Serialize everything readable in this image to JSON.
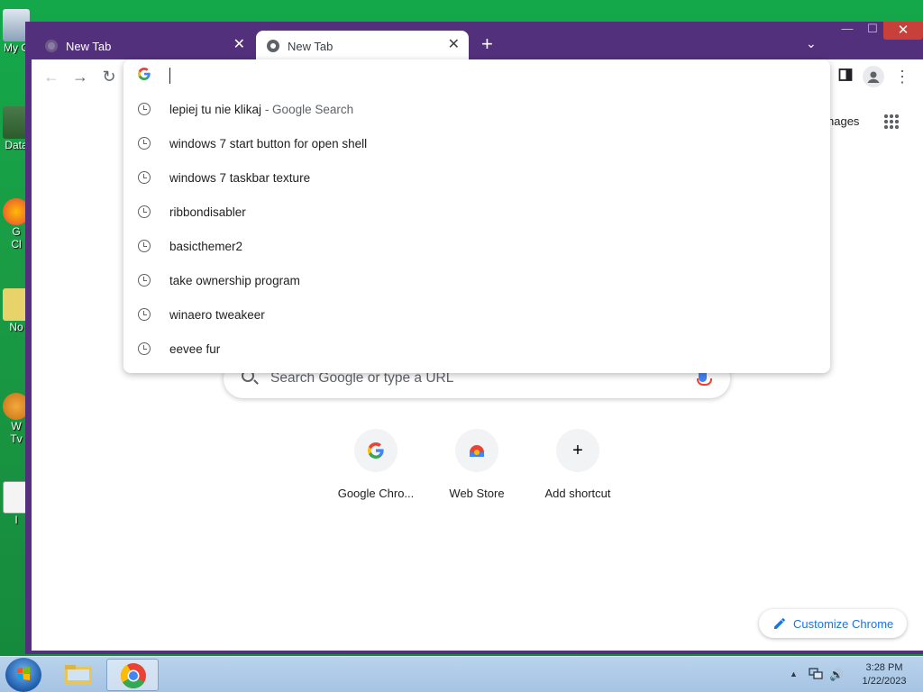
{
  "desktop": {
    "icons": [
      {
        "label": "My C"
      },
      {
        "label": "Data"
      },
      {
        "label": "G"
      },
      {
        "label": "Cl"
      },
      {
        "label": "No"
      },
      {
        "label": "W"
      },
      {
        "label": "Tv"
      },
      {
        "label": "I"
      }
    ]
  },
  "browser": {
    "tabs": [
      {
        "title": "New Tab",
        "close": "✕"
      },
      {
        "title": "New Tab",
        "close": "✕"
      }
    ],
    "new_tab": "+",
    "tab_search": "⌄",
    "window_controls": {
      "minimize": "—",
      "maximize": "☐",
      "close": "✕"
    },
    "toolbar": {
      "back": "←",
      "forward": "→",
      "reload": "↻",
      "menu": "⋮"
    },
    "omnibox": {
      "value": "",
      "suggestions": [
        {
          "text": "lepiej tu nie klikaj",
          "suffix": " - Google Search"
        },
        {
          "text": "windows 7 start button for open shell",
          "suffix": ""
        },
        {
          "text": "windows 7 taskbar texture",
          "suffix": ""
        },
        {
          "text": "ribbondisabler",
          "suffix": ""
        },
        {
          "text": "basicthemer2",
          "suffix": ""
        },
        {
          "text": "take ownership program",
          "suffix": ""
        },
        {
          "text": "winaero tweakeer",
          "suffix": ""
        },
        {
          "text": "eevee fur",
          "suffix": ""
        }
      ]
    }
  },
  "ntp": {
    "images_link": "nages",
    "search_placeholder": "Search Google or type a URL",
    "shortcuts": [
      {
        "label": "Google Chro..."
      },
      {
        "label": "Web Store"
      },
      {
        "label": "Add shortcut",
        "glyph": "+"
      }
    ],
    "customize_label": "Customize Chrome"
  },
  "taskbar": {
    "time": "3:28 PM",
    "date": "1/22/2023",
    "tray_arrow": "▲",
    "speaker": "🔊"
  },
  "colors": {
    "chrome_frame": "#52307c",
    "accent_blue": "#1a73e8",
    "desktop_green": "#1a9c45"
  }
}
